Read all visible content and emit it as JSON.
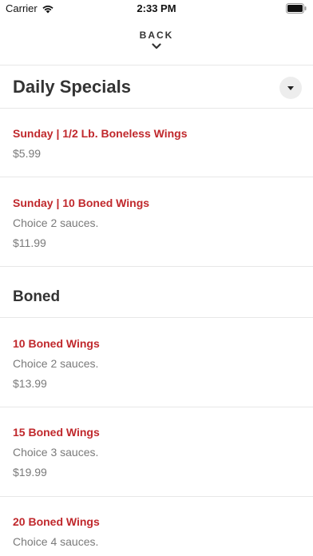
{
  "status_bar": {
    "carrier": "Carrier",
    "time": "2:33 PM"
  },
  "header": {
    "back_label": "BACK"
  },
  "sections": [
    {
      "title": "Daily Specials",
      "items": [
        {
          "name": "Sunday | 1/2 Lb. Boneless Wings",
          "price": "$5.99"
        },
        {
          "name": "Sunday | 10 Boned Wings",
          "description": "Choice 2 sauces.",
          "price": "$11.99"
        }
      ]
    },
    {
      "title": "Boned",
      "items": [
        {
          "name": "10 Boned Wings",
          "description": "Choice 2 sauces.",
          "price": "$13.99"
        },
        {
          "name": "15 Boned Wings",
          "description": "Choice 3 sauces.",
          "price": "$19.99"
        },
        {
          "name": "20 Boned Wings",
          "description": "Choice 4 sauces."
        }
      ]
    }
  ],
  "colors": {
    "item_name": "#c0282c",
    "secondary_text": "#7a7a7a"
  }
}
